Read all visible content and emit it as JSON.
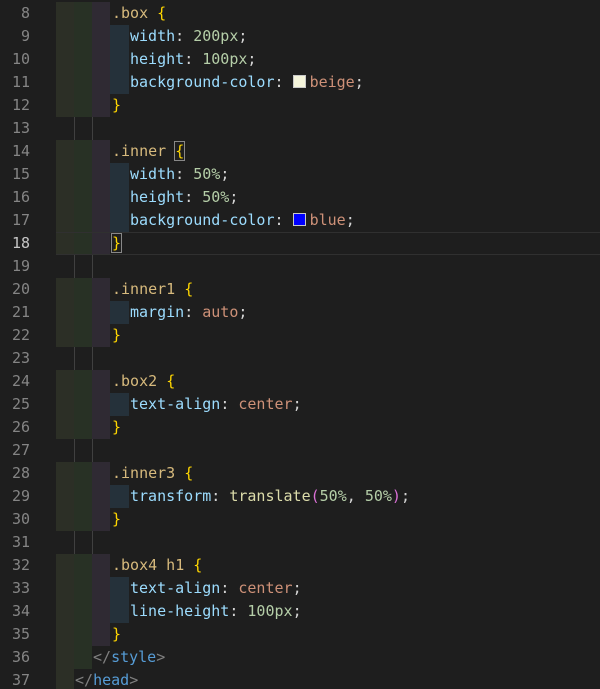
{
  "gutter": {
    "l8": "8",
    "l9": "9",
    "l10": "10",
    "l11": "11",
    "l12": "12",
    "l13": "13",
    "l14": "14",
    "l15": "15",
    "l16": "16",
    "l17": "17",
    "l18": "18",
    "l19": "19",
    "l20": "20",
    "l21": "21",
    "l22": "22",
    "l23": "23",
    "l24": "24",
    "l25": "25",
    "l26": "26",
    "l27": "27",
    "l28": "28",
    "l29": "29",
    "l30": "30",
    "l31": "31",
    "l32": "32",
    "l33": "33",
    "l34": "34",
    "l35": "35",
    "l36": "36",
    "l37": "37"
  },
  "colors": {
    "beige_swatch": "#f5f5dc",
    "blue_swatch": "#0000ff"
  },
  "code": {
    "sel_box": ".box",
    "sel_inner": ".inner",
    "sel_inner1": ".inner1",
    "sel_box2": ".box2",
    "sel_inner3": ".inner3",
    "sel_box4_h1": ".box4 h1",
    "open_brace": "{",
    "close_brace": "}",
    "prop_width": "width",
    "prop_height": "height",
    "prop_bg": "background-color",
    "prop_margin": "margin",
    "prop_text_align": "text-align",
    "prop_transform": "transform",
    "prop_line_height": "line-height",
    "val_200px": "200px",
    "val_100px": "100px",
    "val_beige": "beige",
    "val_50pct": "50%",
    "val_blue": "blue",
    "val_auto": "auto",
    "val_center": "center",
    "fn_translate": "translate",
    "paren_open": "(",
    "paren_close": ")",
    "comma": ", ",
    "colon": ": ",
    "semi": ";",
    "style_close_tag": "style",
    "head_close_tag": "head",
    "lt_slash": "</",
    "gt": ">"
  }
}
